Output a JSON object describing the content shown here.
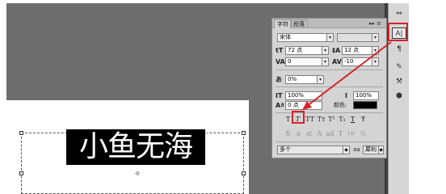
{
  "document": {
    "text_layer_content": "小鱼无海"
  },
  "character_panel": {
    "tabs": [
      "字符",
      "段落"
    ],
    "menu_icon": "panel-menu-icon",
    "font_family": "宋体",
    "font_style": "-",
    "font_size": "72 点",
    "leading": "12 点",
    "kerning": "0",
    "tracking": "-10",
    "tsume": "0%",
    "vertical_scale": "100%",
    "horizontal_scale": "100%",
    "baseline_shift": "0 点",
    "color_label": "颜色:",
    "color_value": "#000000",
    "style_buttons": [
      "T",
      "T",
      "TT",
      "Tт",
      "T¹",
      "T₁",
      "T",
      "Ŧ"
    ],
    "opentype_buttons": [
      "fi",
      "ꝺ",
      "st",
      "A",
      "ad",
      "T",
      "1st",
      "½"
    ],
    "language": "多个",
    "antialias_icon": "aa",
    "antialias": "犀利"
  },
  "dock": {
    "buttons": [
      "dock-collapse-icon",
      "character-panel-icon",
      "paragraph-icon",
      "brush-presets-icon",
      "tool-presets-icon",
      "3d-icon"
    ]
  },
  "annotation": {
    "highlight_color": "#d5232a"
  }
}
